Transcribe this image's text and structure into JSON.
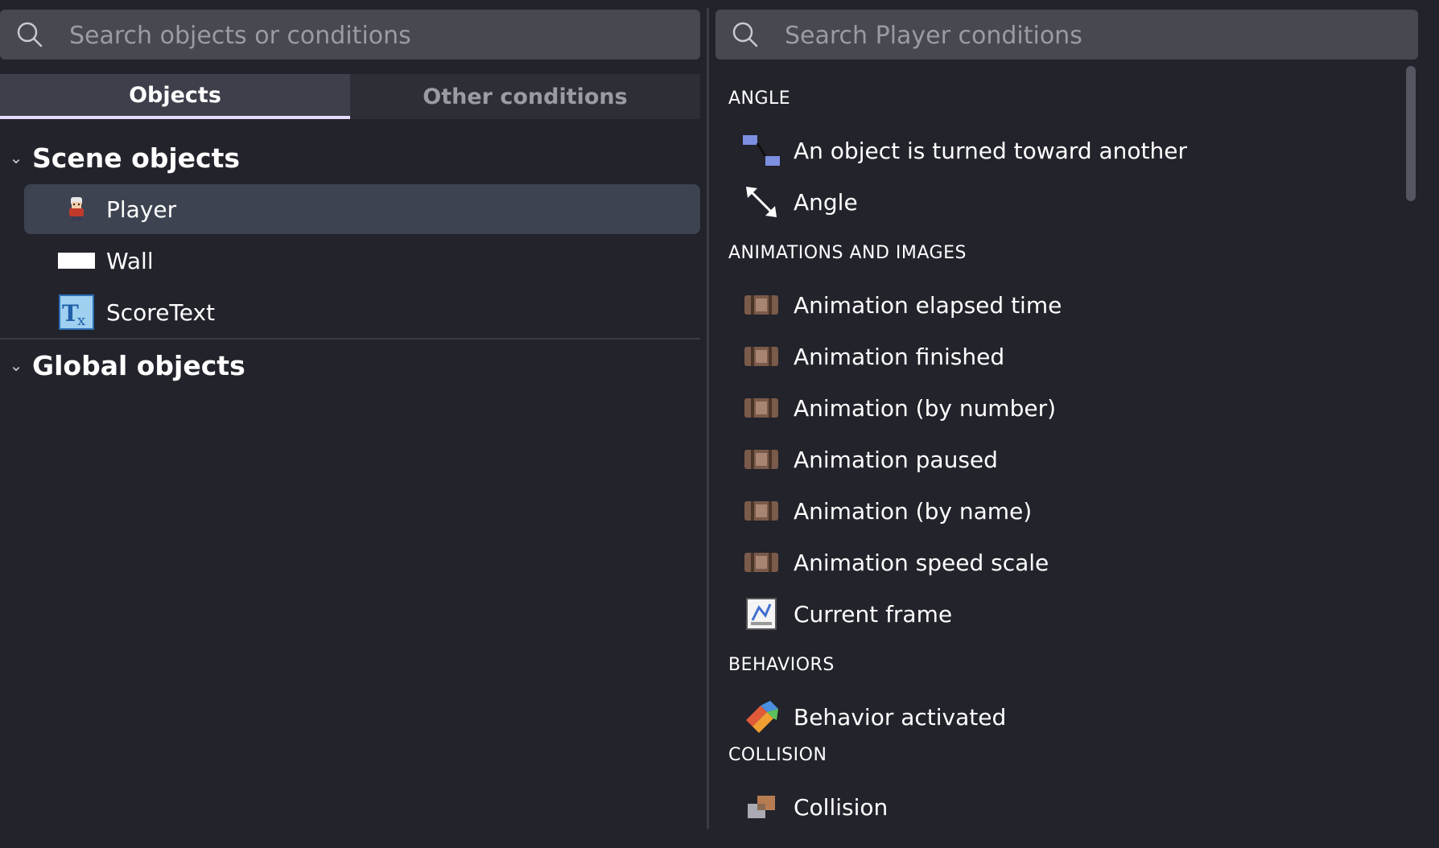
{
  "left_panel": {
    "search": {
      "placeholder": "Search objects or conditions",
      "value": ""
    },
    "tabs": [
      {
        "label": "Objects",
        "active": true
      },
      {
        "label": "Other conditions",
        "active": false
      }
    ],
    "scene_objects": {
      "title": "Scene objects",
      "items": [
        {
          "label": "Player",
          "icon": "player-sprite-icon",
          "selected": true
        },
        {
          "label": "Wall",
          "icon": "wall-rectangle-icon",
          "selected": false
        },
        {
          "label": "ScoreText",
          "icon": "text-object-icon",
          "selected": false
        }
      ]
    },
    "global_objects": {
      "title": "Global objects"
    }
  },
  "right_panel": {
    "search": {
      "placeholder": "Search Player conditions",
      "value": ""
    },
    "categories": [
      {
        "name": "ANGLE",
        "items": [
          {
            "label": "An object is turned toward another",
            "icon": "turned-toward-icon"
          },
          {
            "label": "Angle",
            "icon": "angle-arrow-icon"
          }
        ]
      },
      {
        "name": "ANIMATIONS AND IMAGES",
        "items": [
          {
            "label": "Animation elapsed time",
            "icon": "film-icon"
          },
          {
            "label": "Animation finished",
            "icon": "film-icon"
          },
          {
            "label": "Animation (by number)",
            "icon": "film-icon"
          },
          {
            "label": "Animation paused",
            "icon": "film-icon"
          },
          {
            "label": "Animation (by name)",
            "icon": "film-icon"
          },
          {
            "label": "Animation speed scale",
            "icon": "film-icon"
          },
          {
            "label": "Current frame",
            "icon": "current-frame-icon"
          }
        ]
      },
      {
        "name": "BEHAVIORS",
        "items": [
          {
            "label": "Behavior activated",
            "icon": "behavior-icon"
          }
        ]
      },
      {
        "name": "COLLISION",
        "items": [
          {
            "label": "Collision",
            "icon": "collision-icon"
          }
        ]
      }
    ]
  },
  "colors": {
    "background": "#22232b",
    "search_bg": "#474850",
    "active_tab_bg": "#3d3f4a",
    "tab_indicator": "#e6dcff",
    "selected_row": "#3d4350"
  }
}
